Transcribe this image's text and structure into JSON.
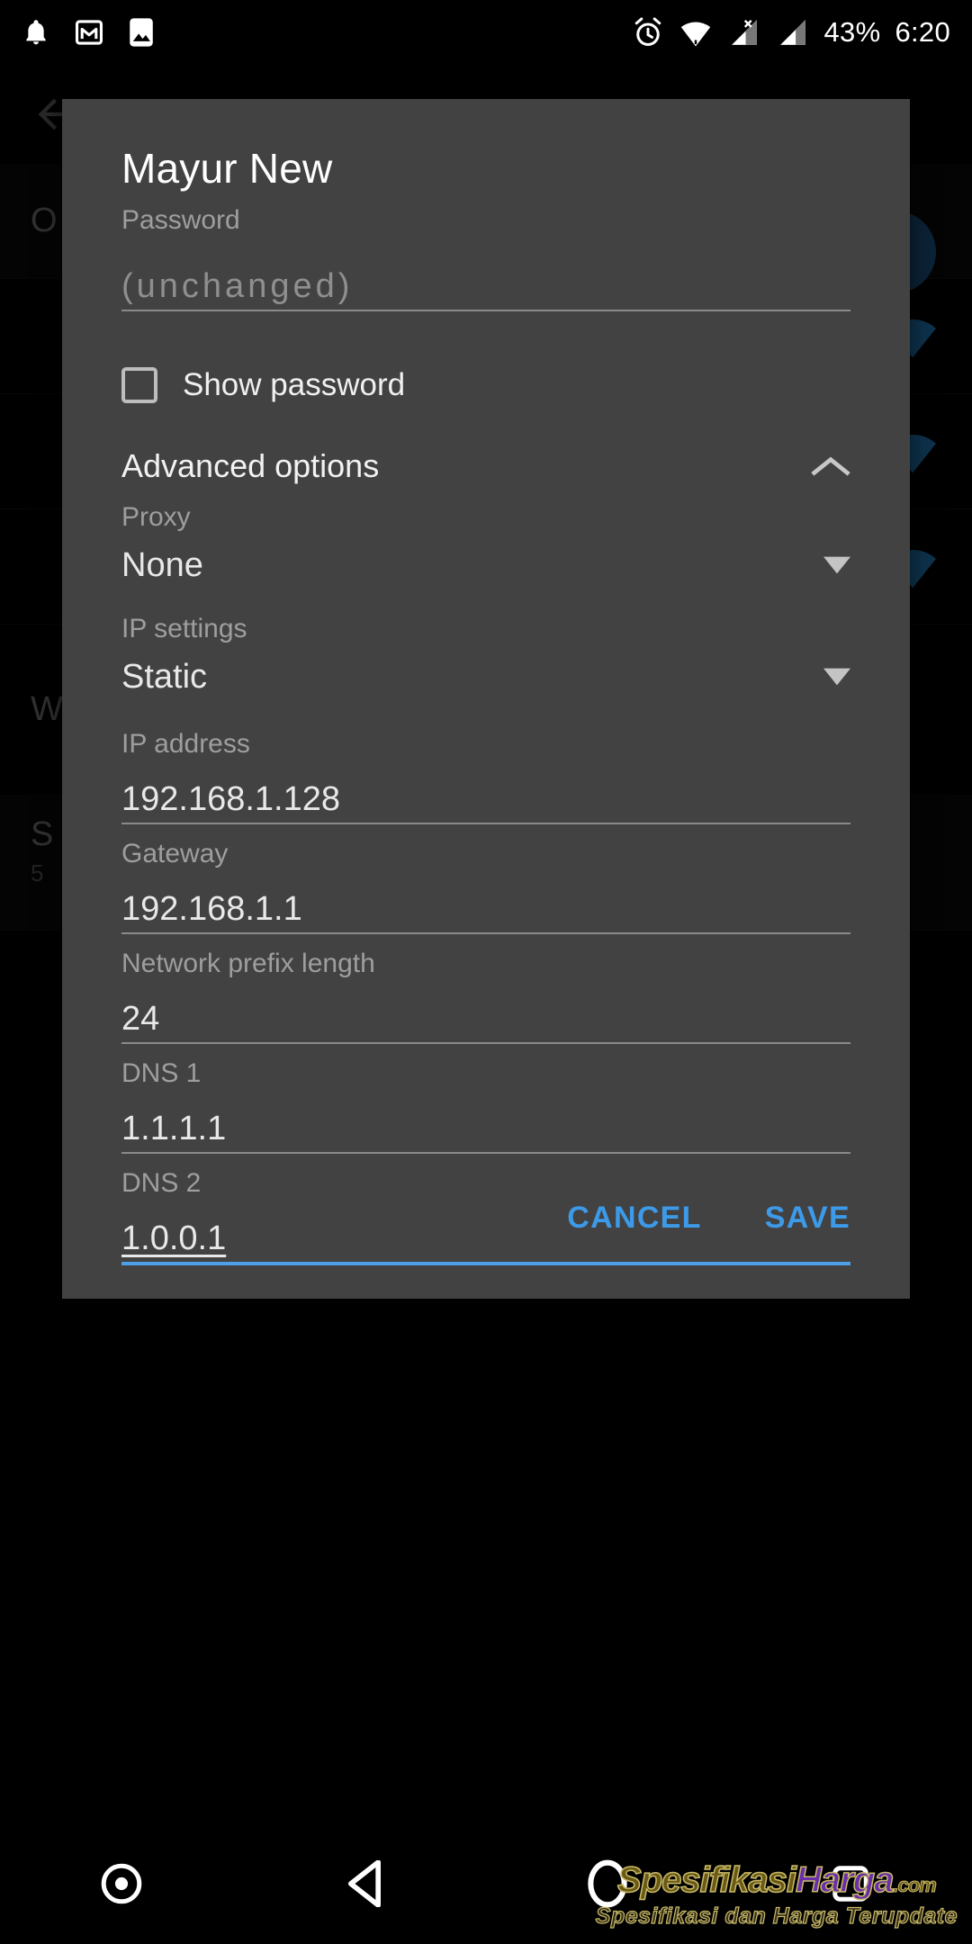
{
  "status_bar": {
    "battery": "43%",
    "time": "6:20",
    "left_icons": [
      "notification-bell-icon",
      "gmail-icon",
      "photo-icon"
    ],
    "right_icons": [
      "alarm-icon",
      "wifi-icon",
      "signal-sim1-icon",
      "signal-sim2-icon"
    ]
  },
  "background_screen": {
    "back_label": "back-arrow",
    "rows": [
      {
        "title": "O",
        "subtitle": "",
        "has_fab": true
      },
      {
        "title": "",
        "subtitle": "",
        "has_fab": false
      },
      {
        "title": "",
        "subtitle": "",
        "has_fab": false
      },
      {
        "title": "",
        "subtitle": "",
        "has_fab": false
      },
      {
        "title": "W",
        "subtitle": "",
        "has_fab": false
      },
      {
        "title": "S",
        "subtitle": "5 ",
        "has_fab": false
      }
    ]
  },
  "dialog": {
    "title": "Mayur New",
    "password": {
      "label": "Password",
      "value": "",
      "placeholder": "(unchanged)"
    },
    "show_password": {
      "label": "Show password",
      "checked": false
    },
    "advanced_options": {
      "label": "Advanced options",
      "expanded": true,
      "chevron": "chevron-up-icon"
    },
    "fields": [
      {
        "label": "Proxy",
        "value": "None",
        "type": "spinner"
      },
      {
        "label": "IP settings",
        "value": "Static",
        "type": "spinner"
      },
      {
        "label": "IP address",
        "value": "192.168.1.128",
        "type": "text"
      },
      {
        "label": "Gateway",
        "value": "192.168.1.1",
        "type": "text"
      },
      {
        "label": "Network prefix length",
        "value": "24",
        "type": "text"
      },
      {
        "label": "DNS 1",
        "value": "1.1.1.1",
        "type": "text"
      },
      {
        "label": "DNS 2",
        "value": "1.0.0.1",
        "type": "text",
        "focused": true
      }
    ],
    "buttons": {
      "cancel": "CANCEL",
      "save": "SAVE"
    },
    "accent_color": "#4d9fe8",
    "surface_color": "#424242"
  },
  "nav_bar": {
    "items": [
      "screenshot-dot-icon",
      "back-triangle-icon",
      "home-circle-icon",
      "recents-square-icon"
    ]
  },
  "watermark": {
    "part1": "Spesifikasi",
    "part2": "Harga",
    "part3": ".com",
    "tagline": "Spesifikasi dan Harga Terupdate"
  }
}
